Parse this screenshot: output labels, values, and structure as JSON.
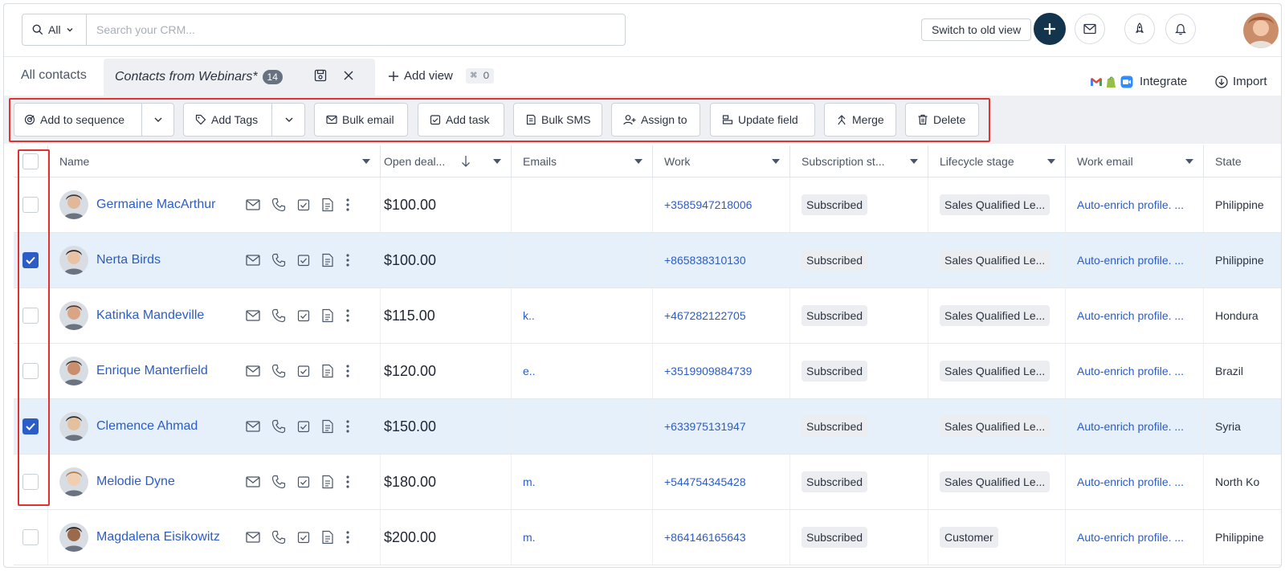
{
  "topbar": {
    "scope_label": "All",
    "search_placeholder": "Search your CRM...",
    "switch_view_label": "Switch to old view"
  },
  "tabs": {
    "all_contacts": "All contacts",
    "active_view": "Contacts from Webinars*",
    "active_count": "14",
    "add_view": "Add view",
    "shortcut": "⌘ O",
    "integrate": "Integrate",
    "import": "Import"
  },
  "actions": {
    "add_to_sequence": "Add to sequence",
    "add_tags": "Add Tags",
    "bulk_email": "Bulk email",
    "add_task": "Add task",
    "bulk_sms": "Bulk SMS",
    "assign_to": "Assign to",
    "update_field": "Update field",
    "merge": "Merge",
    "delete": "Delete"
  },
  "columns": [
    "Name",
    "Open deal...",
    "Emails",
    "Work",
    "Subscription st...",
    "Lifecycle stage",
    "Work email",
    "State"
  ],
  "rows": [
    {
      "name": "Germaine MacArthur",
      "deal": "$100.00",
      "email": "",
      "work": "+3585947218006",
      "subscription": "Subscribed",
      "lifecycle": "Sales Qualified Le...",
      "work_email": "Auto-enrich profile. ...",
      "state": "Philippine",
      "checked": false
    },
    {
      "name": "Nerta Birds",
      "deal": "$100.00",
      "email": "",
      "work": "+865838310130",
      "subscription": "Subscribed",
      "lifecycle": "Sales Qualified Le...",
      "work_email": "Auto-enrich profile. ...",
      "state": "Philippine",
      "checked": true
    },
    {
      "name": "Katinka Mandeville",
      "deal": "$115.00",
      "email": "k..",
      "work": "+467282122705",
      "subscription": "Subscribed",
      "lifecycle": "Sales Qualified Le...",
      "work_email": "Auto-enrich profile. ...",
      "state": "Hondura",
      "checked": false
    },
    {
      "name": "Enrique Manterfield",
      "deal": "$120.00",
      "email": "e..",
      "work": "+3519909884739",
      "subscription": "Subscribed",
      "lifecycle": "Sales Qualified Le...",
      "work_email": "Auto-enrich profile. ...",
      "state": "Brazil",
      "checked": false
    },
    {
      "name": "Clemence Ahmad",
      "deal": "$150.00",
      "email": "",
      "work": "+633975131947",
      "subscription": "Subscribed",
      "lifecycle": "Sales Qualified Le...",
      "work_email": "Auto-enrich profile. ...",
      "state": "Syria",
      "checked": true
    },
    {
      "name": "Melodie Dyne",
      "deal": "$180.00",
      "email": "m.",
      "work": "+544754345428",
      "subscription": "Subscribed",
      "lifecycle": "Sales Qualified Le...",
      "work_email": "Auto-enrich profile. ...",
      "state": "North Ko",
      "checked": false
    },
    {
      "name": "Magdalena Eisikowitz",
      "deal": "$200.00",
      "email": "m.",
      "work": "+864146165643",
      "subscription": "Subscribed",
      "lifecycle": "Customer",
      "work_email": "Auto-enrich profile. ...",
      "state": "Philippine",
      "checked": false
    }
  ],
  "colors": {
    "brand_dark": "#12344d",
    "link": "#2c5cc5",
    "highlight": "#e0322e",
    "selected_row": "#e5f0fb"
  }
}
